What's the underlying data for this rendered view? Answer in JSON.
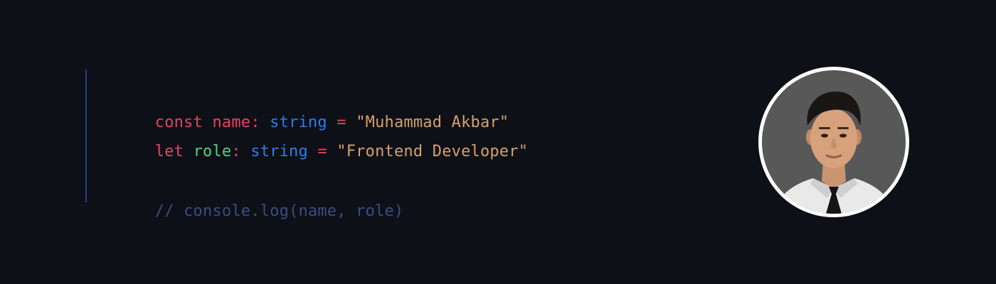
{
  "code": {
    "line1": [
      {
        "text": "const",
        "color": "#e6435f"
      },
      {
        "text": " ",
        "color": "#c9ced8"
      },
      {
        "text": "name",
        "color": "#e6435f"
      },
      {
        "text": ":",
        "color": "#e6435f"
      },
      {
        "text": " ",
        "color": "#c9ced8"
      },
      {
        "text": "string",
        "color": "#2f7bea"
      },
      {
        "text": " ",
        "color": "#c9ced8"
      },
      {
        "text": "=",
        "color": "#e6435f"
      },
      {
        "text": " ",
        "color": "#c9ced8"
      },
      {
        "text": "\"Muhammad Akbar\"",
        "color": "#d7a06a"
      }
    ],
    "line2": [
      {
        "text": "let",
        "color": "#e6435f"
      },
      {
        "text": " ",
        "color": "#c9ced8"
      },
      {
        "text": "role",
        "color": "#4fd37b"
      },
      {
        "text": ":",
        "color": "#e6435f"
      },
      {
        "text": " ",
        "color": "#c9ced8"
      },
      {
        "text": "string",
        "color": "#2f7bea"
      },
      {
        "text": " ",
        "color": "#c9ced8"
      },
      {
        "text": "=",
        "color": "#e6435f"
      },
      {
        "text": " ",
        "color": "#c9ced8"
      },
      {
        "text": "\"Frontend Developer\"",
        "color": "#d7a06a"
      }
    ],
    "comment": {
      "text": "// console.log(name, role)",
      "color": "#3c4c82"
    }
  },
  "theme": {
    "background": "#0d1017",
    "gutter_line": "#2f3f86",
    "avatar_border": "#ffffff"
  },
  "avatar": {
    "icon": "profile-photo"
  }
}
